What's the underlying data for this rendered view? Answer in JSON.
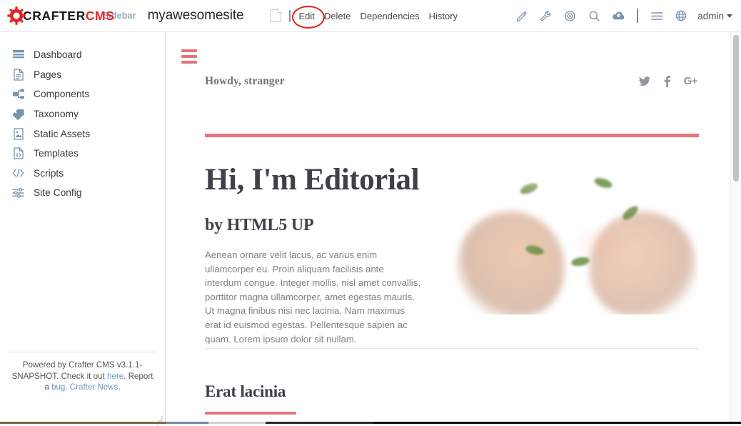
{
  "topbar": {
    "logo": {
      "part1": "CRAFTER",
      "part2": "CMS",
      "icon": "gear-icon"
    },
    "sidebar_toggle": "Sidebar",
    "site_name": "myawesomesite",
    "doc_icon": "page-document-icon",
    "tools": [
      {
        "label": "Edit",
        "circled": true
      },
      {
        "label": "Delete",
        "circled": false
      },
      {
        "label": "Dependencies",
        "circled": false
      },
      {
        "label": "History",
        "circled": false
      }
    ],
    "icons": [
      {
        "name": "pencil-icon"
      },
      {
        "name": "wrench-icon"
      },
      {
        "name": "target-icon"
      },
      {
        "name": "search-icon"
      },
      {
        "name": "cloud-upload-icon"
      }
    ],
    "icons_after_divider": [
      {
        "name": "hamburger-menu-icon"
      },
      {
        "name": "globe-icon"
      }
    ],
    "user_menu": "admin"
  },
  "sidebar": {
    "items": [
      {
        "label": "Dashboard",
        "icon": "dashboard-icon"
      },
      {
        "label": "Pages",
        "icon": "pages-document-icon"
      },
      {
        "label": "Components",
        "icon": "components-icon"
      },
      {
        "label": "Taxonomy",
        "icon": "tag-icon"
      },
      {
        "label": "Static Assets",
        "icon": "image-file-icon"
      },
      {
        "label": "Templates",
        "icon": "template-code-file-icon"
      },
      {
        "label": "Scripts",
        "icon": "code-brackets-icon"
      },
      {
        "label": "Site Config",
        "icon": "sliders-config-icon"
      }
    ],
    "footer": {
      "line1": "Powered by Crafter CMS v3.1.1-SNAPSHOT. Check it out ",
      "link_here": "here",
      "line2": ". Report a ",
      "link_bug": "bug",
      "line3": ". ",
      "link_news": "Crafter News",
      "line4": "."
    }
  },
  "preview": {
    "menu_icon": "hamburger-menu-icon",
    "greeting": "Howdy, stranger",
    "social": [
      {
        "name": "twitter-icon",
        "glyph": "twitter"
      },
      {
        "name": "facebook-icon",
        "glyph": "f"
      },
      {
        "name": "google-plus-icon",
        "glyph": "G+"
      }
    ],
    "headline": "Hi, I'm Editorial",
    "subheadline": "by HTML5 UP",
    "body": "Aenean ornare velit lacus, ac varius enim ullamcorper eu. Proin aliquam facilisis ante interdum congue. Integer mollis, nisl amet convallis, porttitor magna ullamcorper, amet egestas mauris. Ut magna finibus nisi nec lacinia. Nam maximus erat id euismod egestas. Pellentesque sapien ac quam. Lorem ipsum dolor sit nullam.",
    "hero_image_alt": "hands-holding-strawberries",
    "section_title": "Erat lacinia"
  },
  "colors": {
    "brand_red": "#e52421",
    "accent_salmon": "#e8747b",
    "icon_blue": "#7893ad",
    "text_dark": "#3d4148",
    "text_muted": "#7b8086",
    "annotation_red": "#e1251b"
  }
}
